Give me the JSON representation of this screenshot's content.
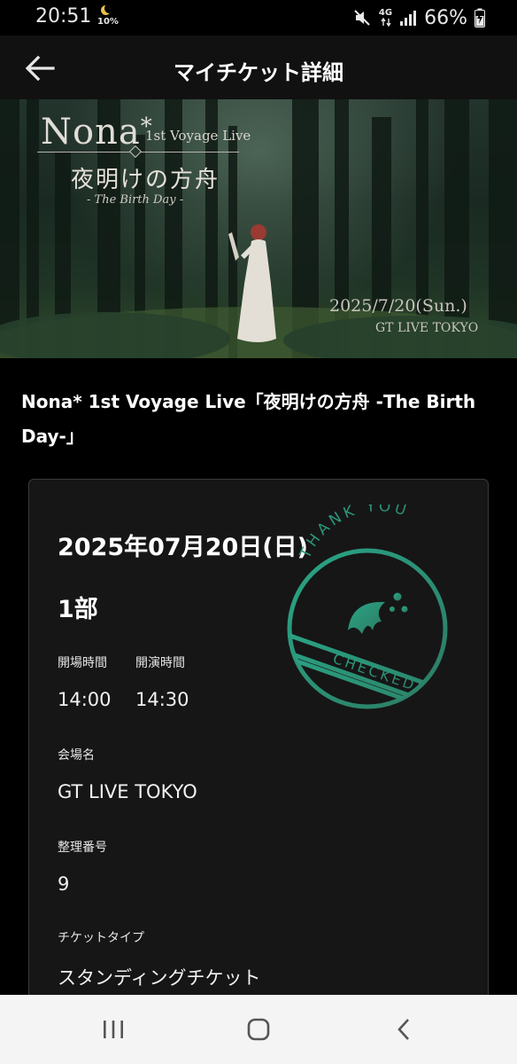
{
  "status_bar": {
    "time": "20:51",
    "moon_percent": "10%",
    "network_label": "4G",
    "battery_percent": "66%"
  },
  "app_bar": {
    "title": "マイチケット詳細",
    "back_icon": "arrow-left-icon"
  },
  "hero": {
    "artist": "Nona",
    "artist_star": "*",
    "subtitle": "1st Voyage Live",
    "title_jp": "夜明けの方舟",
    "title_en": "- The Birth Day -",
    "date": "2025/7/20(Sun.)",
    "venue": "GT LIVE TOKYO"
  },
  "event": {
    "title": "Nona* 1st Voyage Live「夜明けの方舟 -The Birth Day-」"
  },
  "ticket": {
    "date": "2025年07月20日(日)",
    "part": "1部",
    "open_label": "開場時間",
    "open_time": "14:00",
    "start_label": "開演時間",
    "start_time": "14:30",
    "venue_label": "会場名",
    "venue": "GT LIVE TOKYO",
    "number_label": "整理番号",
    "number": "9",
    "type_label": "チケットタイプ",
    "type": "スタンディングチケット"
  },
  "stamp": {
    "top_text": "THANK YOU",
    "band_text": "CHECKED!",
    "color": "#2e8f72"
  },
  "nav_bar": {
    "recents_icon": "recent-apps-icon",
    "home_icon": "home-icon",
    "back_icon": "back-chevron-icon"
  }
}
